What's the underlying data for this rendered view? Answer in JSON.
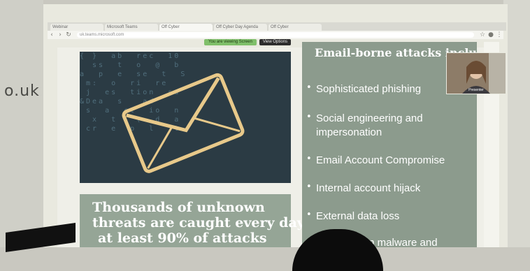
{
  "room": {
    "whiteboard_text": "o.uk"
  },
  "browser": {
    "tabs": [
      {
        "label": "Webinar",
        "active": false
      },
      {
        "label": "Microsoft Teams",
        "active": false
      },
      {
        "label": "Off Cyber",
        "active": true
      },
      {
        "label": "Off Cyber Day Agenda",
        "active": false
      },
      {
        "label": "Off Cyber",
        "active": false
      }
    ],
    "url": "uk.teams.microsoft.com",
    "share_label": "You are viewing Screen",
    "view_options_label": "View Options"
  },
  "slide": {
    "hero_image": "email-envelope-image",
    "quote_lines": [
      "Thousands of unknown",
      "threats are caught every day",
      "at least 90% of attacks"
    ],
    "panel_title": "Email-borne attacks inclu",
    "bullets": [
      [
        "Sophisticated phishing"
      ],
      [
        "Social engineering and",
        "impersonation"
      ],
      [
        "Email Account Compromise"
      ],
      [
        "Internal account hijack"
      ],
      [
        "External data loss"
      ],
      [
        "own malware and"
      ]
    ]
  },
  "participant": {
    "name": "Presenter"
  },
  "colors": {
    "panel": "#8c9b8d",
    "quote_box": "#95a596",
    "share_pill": "#7fbf6a"
  }
}
